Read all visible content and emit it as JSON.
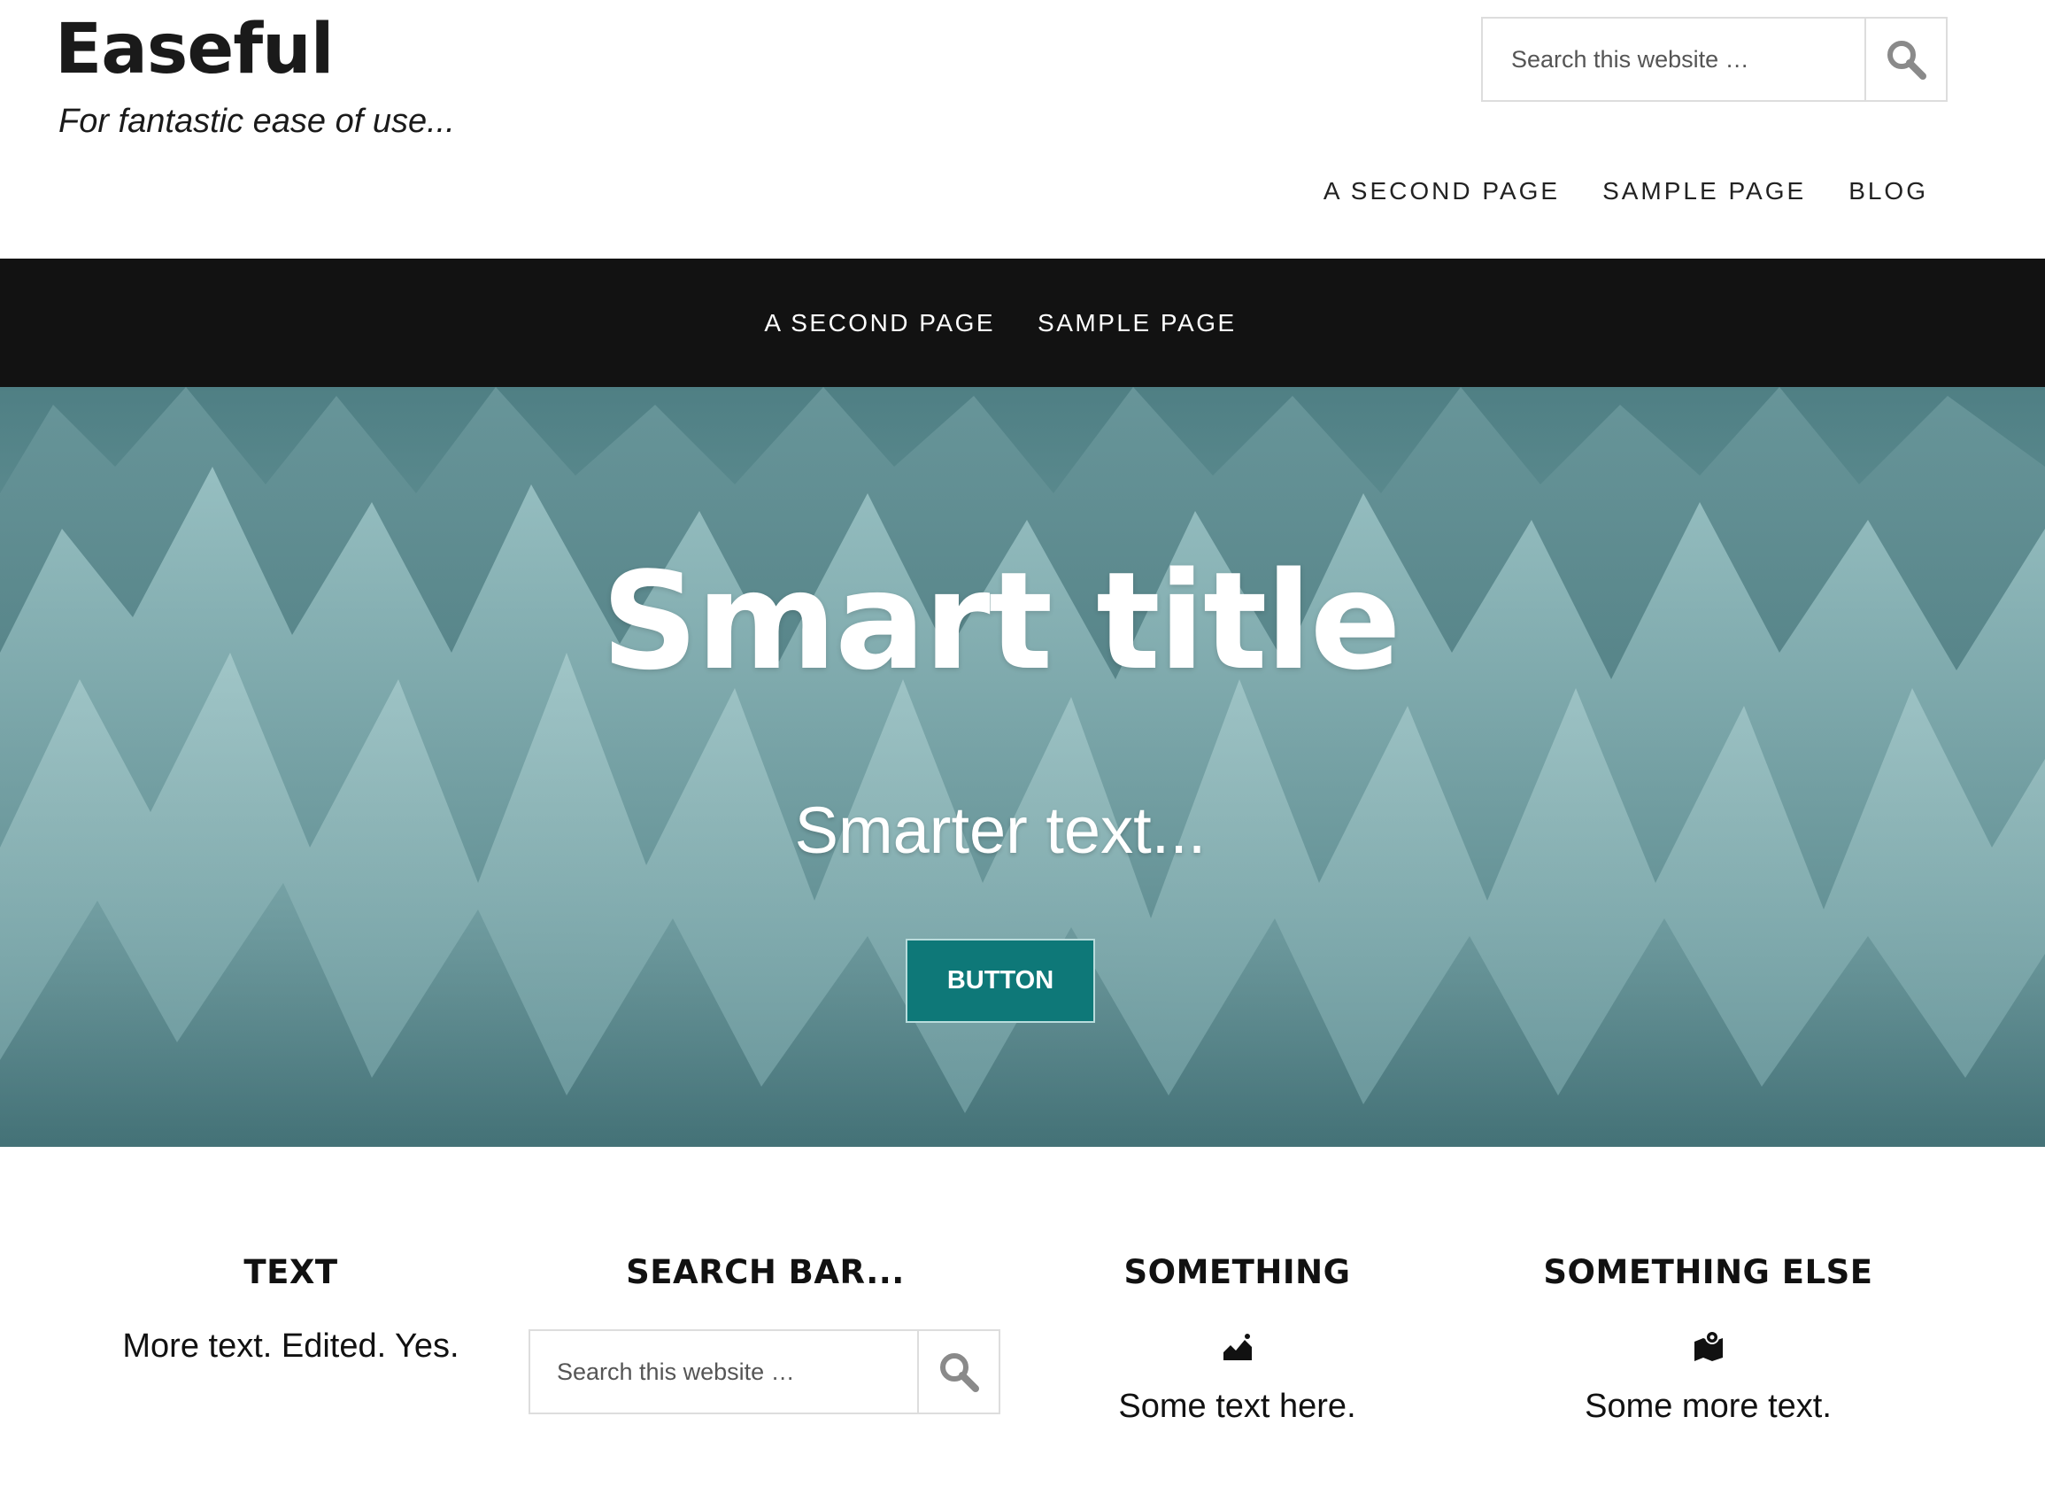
{
  "site": {
    "title": "Easeful",
    "tagline": "For fantastic ease of use..."
  },
  "header_search": {
    "placeholder": "Search this website …",
    "icon": "search-icon"
  },
  "header_nav": [
    "A SECOND PAGE",
    "SAMPLE PAGE",
    "BLOG"
  ],
  "secondary_nav": [
    "A SECOND PAGE",
    "SAMPLE PAGE"
  ],
  "hero": {
    "title": "Smart title",
    "subtitle": "Smarter text...",
    "button_label": "BUTTON",
    "button_color": "#0e7878",
    "background": "glacier-ice-photo"
  },
  "widgets": [
    {
      "title": "TEXT",
      "text": "More text. Edited. Yes."
    },
    {
      "title": "SEARCH BAR...",
      "search_placeholder": "Search this website …",
      "icon": "search-icon"
    },
    {
      "title": "SOMETHING",
      "icon": "chart-area-icon",
      "text": "Some text here."
    },
    {
      "title": "SOMETHING ELSE",
      "icon": "map-pin-icon",
      "text": "Some more text."
    }
  ],
  "colors": {
    "accent": "#0e7878",
    "nav_bar": "#121212",
    "text": "#111111"
  }
}
